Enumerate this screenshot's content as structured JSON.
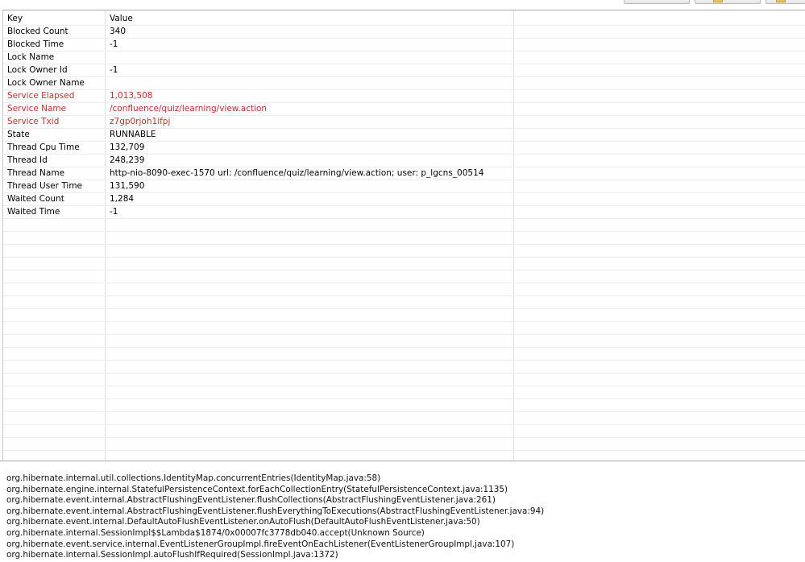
{
  "table": {
    "headers": {
      "key": "Key",
      "value": "Value"
    },
    "rows": [
      {
        "key": "Blocked Count",
        "value": "340",
        "highlight": false
      },
      {
        "key": "Blocked Time",
        "value": "-1",
        "highlight": false
      },
      {
        "key": "Lock Name",
        "value": "",
        "highlight": false
      },
      {
        "key": "Lock Owner Id",
        "value": "-1",
        "highlight": false
      },
      {
        "key": "Lock Owner Name",
        "value": "",
        "highlight": false
      },
      {
        "key": "Service Elapsed",
        "value": "1,013,508",
        "highlight": true
      },
      {
        "key": "Service Name",
        "value": "/confluence/quiz/learning/view.action",
        "highlight": true
      },
      {
        "key": "Service Txid",
        "value": "z7gp0rjoh1ifpj",
        "highlight": true
      },
      {
        "key": "State",
        "value": "RUNNABLE",
        "highlight": false
      },
      {
        "key": "Thread Cpu Time",
        "value": "132,709",
        "highlight": false
      },
      {
        "key": "Thread Id",
        "value": "248,239",
        "highlight": false
      },
      {
        "key": "Thread Name",
        "value": "http-nio-8090-exec-1570 url: /confluence/quiz/learning/view.action; user: p_lgcns_00514",
        "highlight": false
      },
      {
        "key": "Thread User Time",
        "value": "131,590",
        "highlight": false
      },
      {
        "key": "Waited Count",
        "value": "1,284",
        "highlight": false
      },
      {
        "key": "Waited Time",
        "value": "-1",
        "highlight": false
      }
    ]
  },
  "stack_trace": [
    "org.hibernate.internal.util.collections.IdentityMap.concurrentEntries(IdentityMap.java:58)",
    "org.hibernate.engine.internal.StatefulPersistenceContext.forEachCollectionEntry(StatefulPersistenceContext.java:1135)",
    "org.hibernate.event.internal.AbstractFlushingEventListener.flushCollections(AbstractFlushingEventListener.java:261)",
    "org.hibernate.event.internal.AbstractFlushingEventListener.flushEverythingToExecutions(AbstractFlushingEventListener.java:94)",
    "org.hibernate.event.internal.DefaultAutoFlushEventListener.onAutoFlush(DefaultAutoFlushEventListener.java:50)",
    "org.hibernate.internal.SessionImpl$$Lambda$1874/0x00007fc3778db040.accept(Unknown Source)",
    "org.hibernate.event.service.internal.EventListenerGroupImpl.fireEventOnEachListener(EventListenerGroupImpl.java:107)",
    "org.hibernate.internal.SessionImpl.autoFlushIfRequired(SessionImpl.java:1372)"
  ],
  "colors": {
    "highlight_text": "#d12b2b",
    "grid_line": "#ececec"
  }
}
